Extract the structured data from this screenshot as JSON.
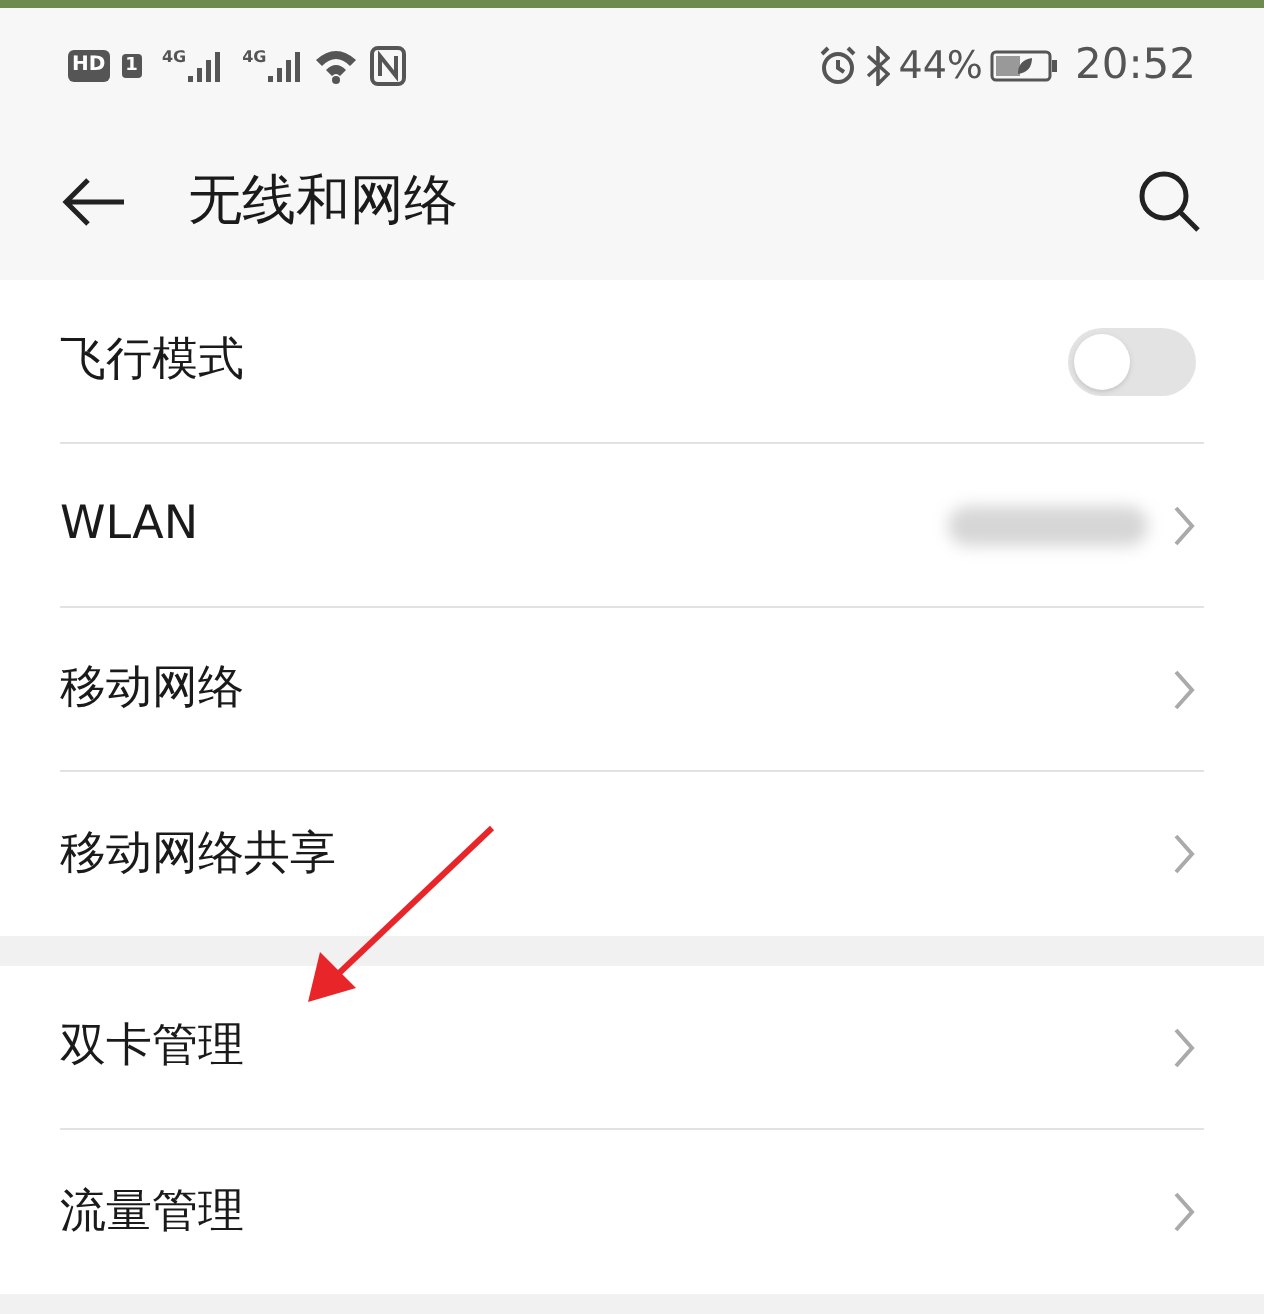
{
  "status_bar": {
    "hd_badge": "HD",
    "sim_badge": "1",
    "networks": [
      "4G",
      "4G"
    ],
    "battery": "44%",
    "time": "20:52"
  },
  "header": {
    "title": "无线和网络"
  },
  "groups": [
    {
      "items": [
        {
          "kind": "toggle",
          "label": "飞行模式",
          "on": false
        },
        {
          "kind": "chevron",
          "label": "WLAN",
          "value_blurred": true
        },
        {
          "kind": "chevron",
          "label": "移动网络"
        },
        {
          "kind": "chevron",
          "label": "移动网络共享"
        }
      ]
    },
    {
      "items": [
        {
          "kind": "chevron",
          "label": "双卡管理"
        },
        {
          "kind": "chevron",
          "label": "流量管理"
        }
      ]
    }
  ],
  "annotation": {
    "kind": "arrow"
  }
}
